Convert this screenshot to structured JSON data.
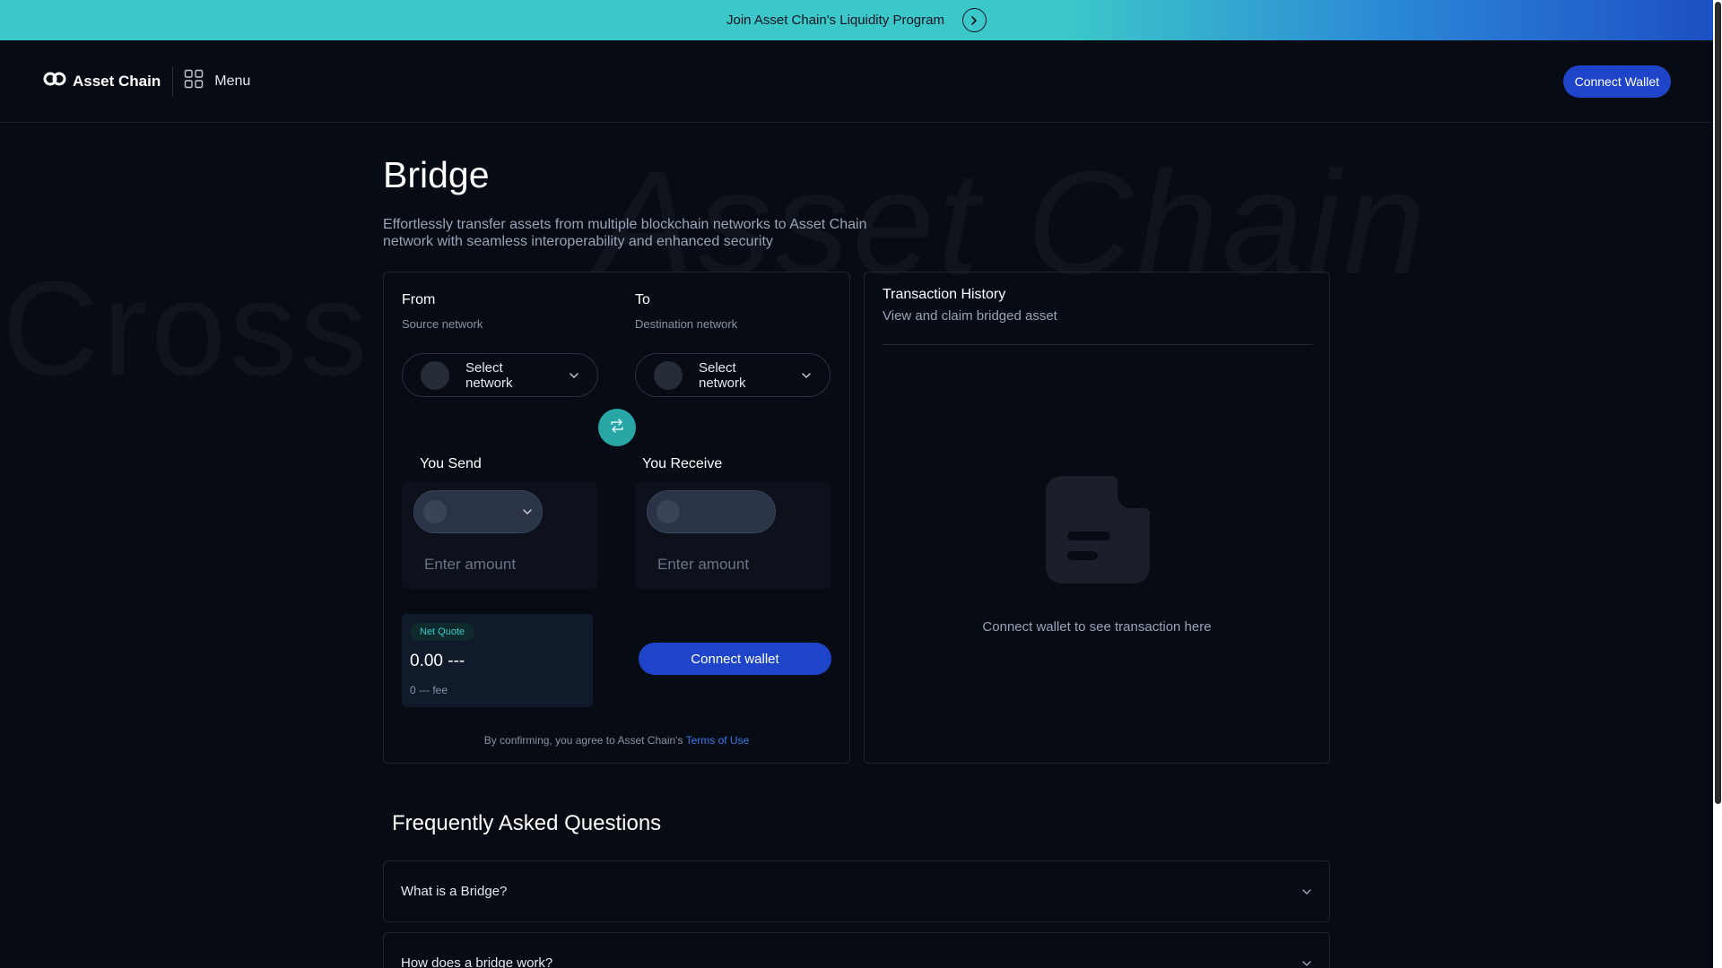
{
  "banner": {
    "text": "Join Asset Chain's Liquidity Program"
  },
  "header": {
    "logo_text": "Asset Chain",
    "menu_label": "Menu",
    "connect_label": "Connect Wallet"
  },
  "watermark": {
    "line1": "Asset Chain",
    "line2": "Cross"
  },
  "page": {
    "title": "Bridge",
    "description": "Effortlessly transfer assets from multiple blockchain networks to Asset Chain network with seamless interoperability and enhanced security"
  },
  "bridge": {
    "from_label": "From",
    "from_sub": "Source network",
    "to_label": "To",
    "to_sub": "Destination network",
    "source_select": "Select network",
    "dest_select": "Select network",
    "send_label": "You Send",
    "receive_label": "You Receive",
    "send_placeholder": "Enter amount",
    "receive_placeholder": "Enter amount",
    "quote_badge": "Net Quote",
    "quote_value": "0.00 ---",
    "quote_fee": "0 --- fee",
    "connect_label": "Connect wallet",
    "terms_prefix": "By confirming, you agree to Asset Chain's",
    "terms_link": "Terms of Use"
  },
  "history": {
    "title": "Transaction History",
    "subtitle": "View and claim bridged asset",
    "empty_text": "Connect wallet to see transaction here"
  },
  "faq": {
    "title": "Frequently Asked Questions",
    "items": [
      {
        "question": "What is a Bridge?"
      },
      {
        "question": "How does a bridge work?"
      }
    ]
  },
  "colors": {
    "accent_teal": "#3cc8c9",
    "primary_blue": "#1e45c9",
    "background": "#070b14"
  },
  "icons": [
    "logo-icon",
    "menu-grid-icon",
    "chevron-right-icon",
    "chevron-down-icon",
    "swap-icon",
    "document-icon"
  ]
}
